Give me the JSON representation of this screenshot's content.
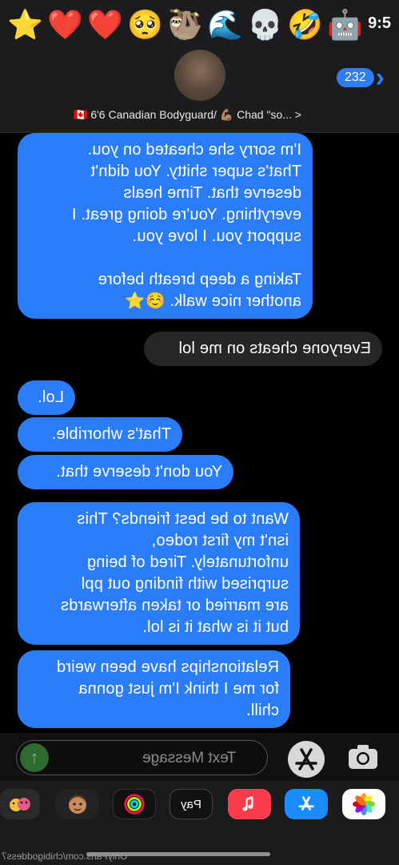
{
  "status_bar": {
    "time": "9:5",
    "emojis": [
      "⭐",
      "❤️",
      "❤️",
      "🥺",
      "🦥",
      "🌊",
      "💀",
      "🤣",
      "🤖"
    ]
  },
  "header": {
    "back_count": "232",
    "contact_name": "🇨🇦 6'6 Canadian Bodyguard/ 💪🏽 Chad \"so... >"
  },
  "messages": [
    {
      "side": "received",
      "text": "I'm sorry she cheated on you.\nThat's super shitty. You didn't\ndeserve that. Time heals\neverything. You're doing great. I\nsupport you. I love you.\n\nTaking a deep breath before\nanother nice walk. ☺️⭐"
    },
    {
      "side": "sent",
      "text": "Everyone cheats on me lol"
    },
    {
      "side": "received",
      "text": "Lol."
    },
    {
      "side": "received",
      "text": "That's whorrible."
    },
    {
      "side": "received",
      "text": "You don't deserve that."
    },
    {
      "side": "received",
      "text": "Want to be best friends? This\nisn't my first rodeo,\nunfortunately. Tired of being\nsurprised with finding out ppl\nare married or taken afterwards\nbut it is what it is lol."
    },
    {
      "side": "received",
      "text": "Relationships have been weird\nfor me I think I'm just gonna\nchill."
    }
  ],
  "compose": {
    "placeholder": "Text Message"
  },
  "dock": {
    "apps": [
      "photos-icon",
      "app-store-icon",
      "music-icon",
      "apple-pay-icon",
      "fitness-icon",
      "memoji-icon",
      "animoji-icon"
    ],
    "pay_label": "Pay"
  },
  "watermark": "OnlyFans.com/chibigoddess7"
}
